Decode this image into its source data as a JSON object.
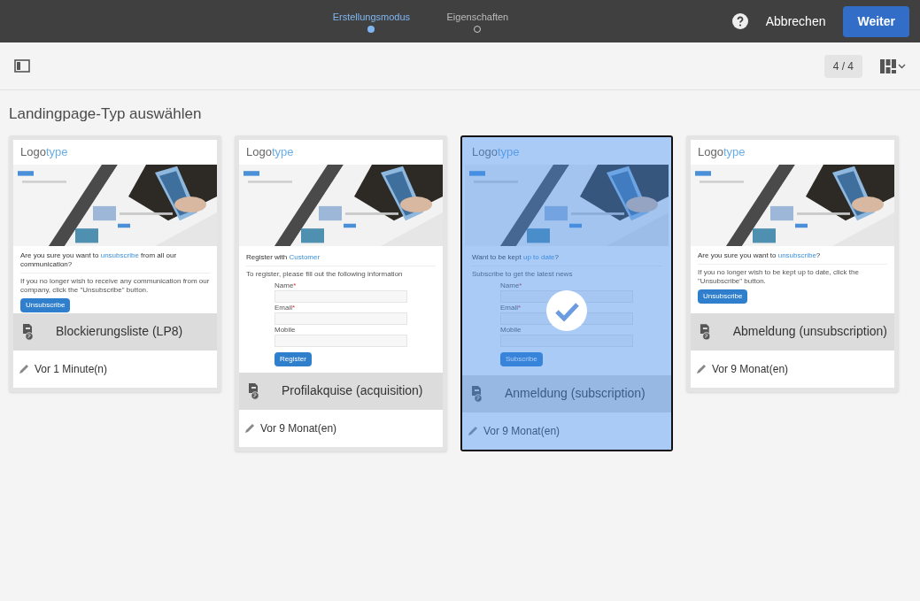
{
  "header": {
    "steps": [
      {
        "label": "Erstellungsmodus",
        "selected": true
      },
      {
        "label": "Eigenschaften",
        "selected": false
      }
    ],
    "cancel": "Abbrechen",
    "next": "Weiter"
  },
  "toolbar": {
    "count": "4 / 4"
  },
  "heading": "Landingpage-Typ auswählen",
  "cards": [
    {
      "selected": false,
      "title": "Blockierungsliste (LP8)",
      "modified": "Vor 1 Minute(n)",
      "preview": {
        "kind": "message",
        "logo": "Logo",
        "logo_accent": "type",
        "heading": {
          "before": "Are you sure you want to ",
          "accent": "unsubscribe",
          "after": " from all our communication?"
        },
        "text": "If you no longer wish to receive any communication from our company, click the \"Unsubscribe\" button.",
        "button": "Unsubscribe"
      }
    },
    {
      "selected": false,
      "title": "Profilakquise (acquisition)",
      "modified": "Vor 9 Monat(en)",
      "preview": {
        "kind": "form",
        "logo": "Logo",
        "logo_accent": "type",
        "heading": {
          "before": "Register with ",
          "accent": "Customer"
        },
        "text": "To register, please fill out the following information",
        "fields": [
          {
            "label": "Name",
            "required_mark": "*"
          },
          {
            "label": "Email",
            "required_mark": "*"
          },
          {
            "label": "Mobile"
          }
        ],
        "button": "Register"
      }
    },
    {
      "selected": true,
      "title": "Anmeldung (subscription)",
      "modified": "Vor 9 Monat(en)",
      "preview": {
        "kind": "form",
        "logo": "Logo",
        "logo_accent": "type",
        "heading": {
          "before": "Want to be kept ",
          "accent": "up to date",
          "after": "?"
        },
        "text": "Subscribe to get the latest news",
        "fields": [
          {
            "label": "Name",
            "required_mark": "*"
          },
          {
            "label": "Email",
            "required_mark": "*"
          },
          {
            "label": "Mobile"
          }
        ],
        "button": "Subscribe"
      }
    },
    {
      "selected": false,
      "title": "Abmeldung (unsubscription)",
      "modified": "Vor 9 Monat(en)",
      "preview": {
        "kind": "message",
        "logo": "Logo",
        "logo_accent": "type",
        "heading": {
          "before": "Are you sure you want to ",
          "accent": "unsubscribe",
          "after": "?"
        },
        "text": "If you no longer wish to be kept up to date, click the \"Unsubscribe\" button.",
        "button": "Unsubscribe"
      }
    }
  ]
}
